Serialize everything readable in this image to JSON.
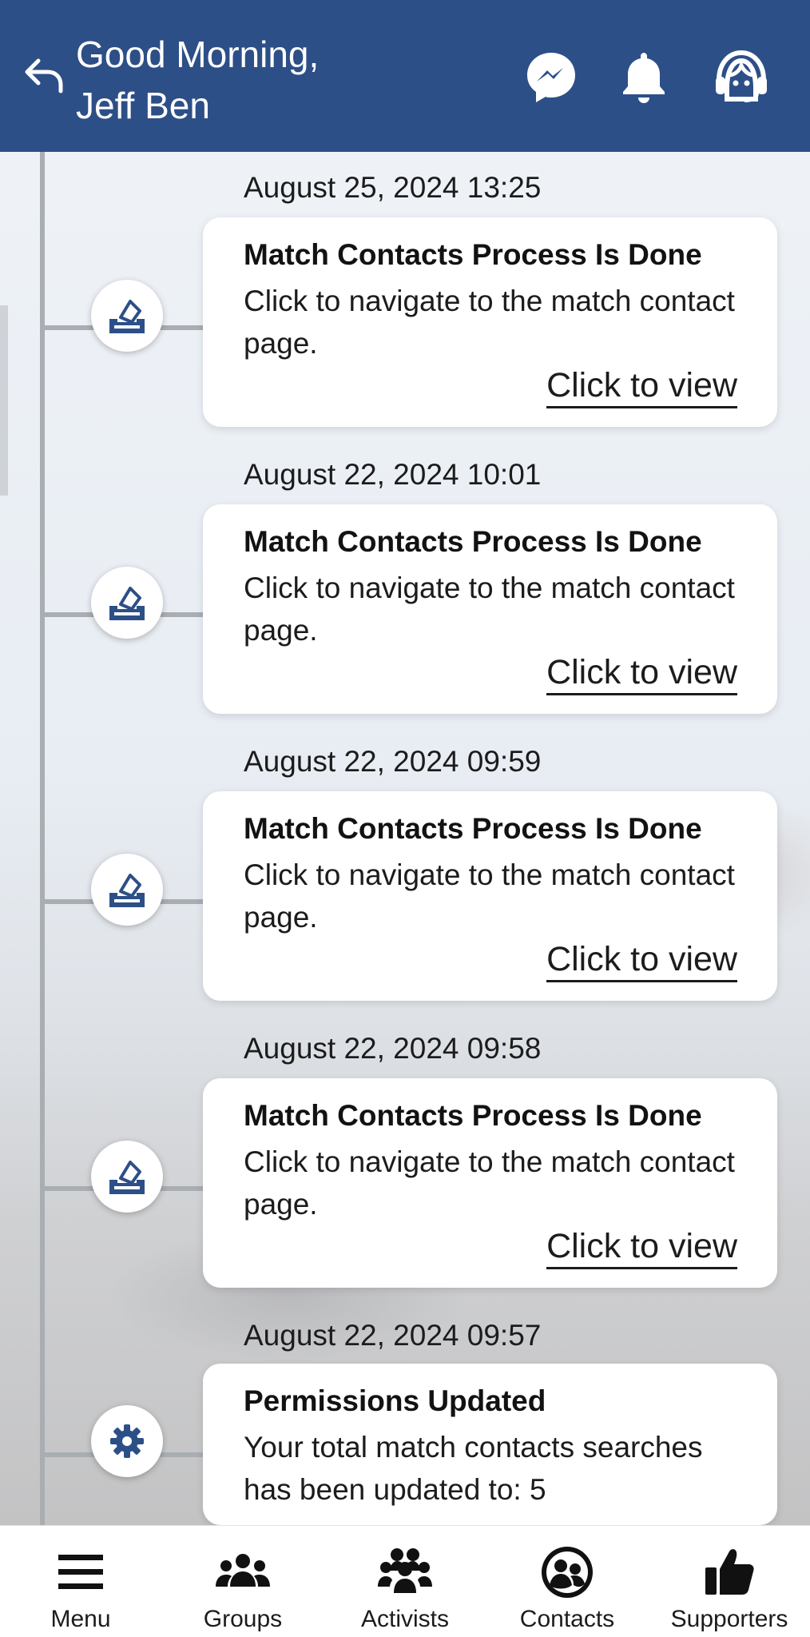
{
  "header": {
    "greeting_line1": "Good Morning,",
    "greeting_line2": "Jeff Ben",
    "background_color": "#2d4f87",
    "icons": [
      "back-arrow-icon",
      "messenger-icon",
      "bell-icon",
      "support-agent-icon"
    ]
  },
  "timeline": {
    "entries": [
      {
        "date": "August 25, 2024 13:25",
        "icon": "ballot-box-icon",
        "title": "Match Contacts Process Is Done",
        "body": "Click to navigate to the match contact page.",
        "link": "Click to view"
      },
      {
        "date": "August 22, 2024 10:01",
        "icon": "ballot-box-icon",
        "title": "Match Contacts Process Is Done",
        "body": "Click to navigate to the match contact page.",
        "link": "Click to view"
      },
      {
        "date": "August 22, 2024 09:59",
        "icon": "ballot-box-icon",
        "title": "Match Contacts Process Is Done",
        "body": "Click to navigate to the match contact page.",
        "link": "Click to view"
      },
      {
        "date": "August 22, 2024 09:58",
        "icon": "ballot-box-icon",
        "title": "Match Contacts Process Is Done",
        "body": "Click to navigate to the match contact page.",
        "link": "Click to view"
      },
      {
        "date": "August 22, 2024 09:57",
        "icon": "gear-icon",
        "title": "Permissions Updated",
        "body": "Your total match contacts searches has been updated to: 5"
      }
    ]
  },
  "bottom_nav": {
    "items": [
      {
        "label": "Menu",
        "icon": "hamburger-menu-icon"
      },
      {
        "label": "Groups",
        "icon": "groups-icon"
      },
      {
        "label": "Activists",
        "icon": "activists-icon"
      },
      {
        "label": "Contacts",
        "icon": "contacts-icon"
      },
      {
        "label": "Supporters",
        "icon": "thumbs-up-icon"
      }
    ]
  },
  "colors": {
    "brand_blue": "#2d4f87",
    "timeline_line": "#a9aeb3",
    "card_background": "#ffffff"
  }
}
